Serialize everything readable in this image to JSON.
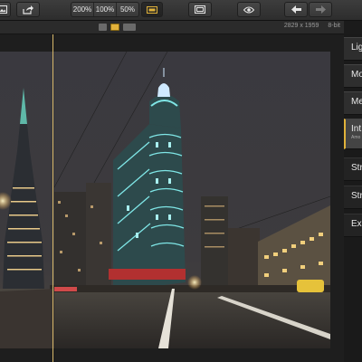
{
  "toolbar": {
    "zoom_options": [
      "200%",
      "100%",
      "50%"
    ],
    "buttons": {
      "open": "open-image-icon",
      "share": "share-icon",
      "fit": "fit-to-screen-icon",
      "frame": "frame-view-icon",
      "preview": "eye-icon",
      "undo": "undo-icon",
      "redo": "redo-icon"
    }
  },
  "image_info": {
    "dimensions": "2829 x 1959",
    "bit_depth": "8-bit"
  },
  "panel": {
    "items": [
      {
        "label": "Lig"
      },
      {
        "label": "Mo"
      },
      {
        "label": "Me"
      },
      {
        "label": "Int",
        "sub": "Amo"
      },
      {
        "label": "Str"
      },
      {
        "label": "Str"
      },
      {
        "label": "Ex"
      }
    ]
  },
  "colors": {
    "accent": "#e0b23a",
    "split_line": "#d7b86a",
    "tower_glow": "#7fe6e6"
  }
}
